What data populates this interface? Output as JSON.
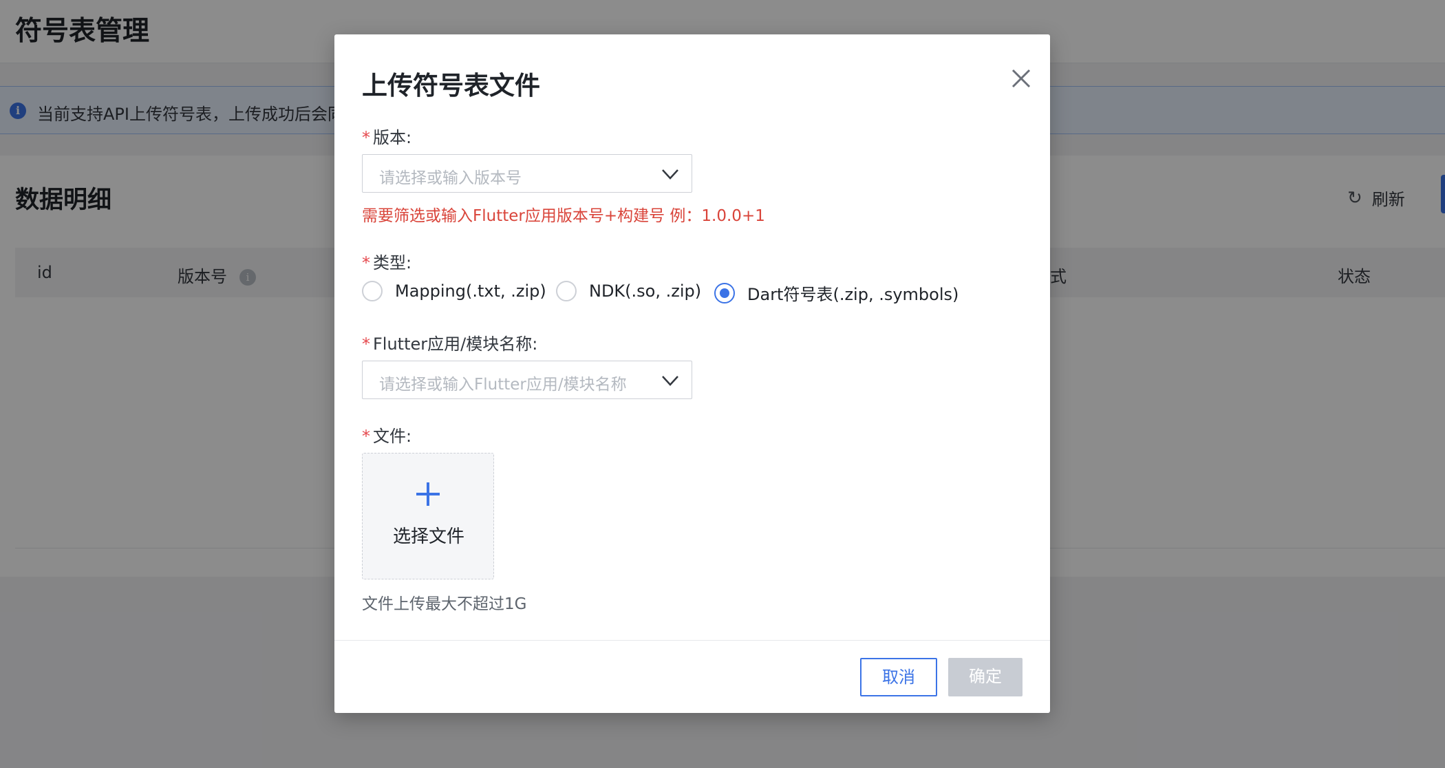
{
  "page": {
    "title": "符号表管理",
    "notice": "当前支持API上传符号表，上传成功后会同",
    "section_title": "数据明细",
    "refresh_label": "刷新",
    "icons": {
      "notice": "info-icon",
      "refresh": "refresh-icon",
      "column_info": "info-icon"
    },
    "table_headers": [
      "id",
      "版本号",
      "方式",
      "状态"
    ]
  },
  "modal": {
    "title": "上传符号表文件",
    "close_icon": "close-icon",
    "required_mark": "*",
    "version": {
      "label": "版本:",
      "placeholder": "请选择或输入版本号",
      "hint": "需要筛选或输入Flutter应用版本号+构建号 例：1.0.0+1"
    },
    "type": {
      "label": "类型:",
      "options": [
        {
          "label": "Mapping(.txt, .zip)",
          "checked": false
        },
        {
          "label": "NDK(.so, .zip)",
          "checked": false
        },
        {
          "label": "Dart符号表(.zip, .symbols)",
          "checked": true
        }
      ]
    },
    "module": {
      "label": "Flutter应用/模块名称:",
      "placeholder": "请选择或输入Flutter应用/模块名称"
    },
    "file": {
      "label": "文件:",
      "upload_label": "选择文件",
      "hint": "文件上传最大不超过1G"
    },
    "buttons": {
      "cancel": "取消",
      "ok": "确定"
    },
    "colors": {
      "primary": "#3b73e6",
      "error": "#d9443a",
      "disabled": "#c8ccd3"
    }
  }
}
